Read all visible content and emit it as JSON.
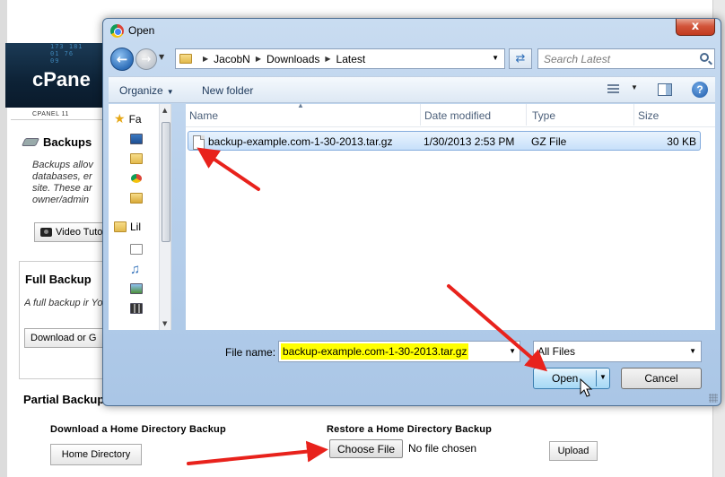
{
  "background": {
    "header_digits": "173 181\n01 76\n09",
    "logo": "cPane",
    "version": "CPANEL 11",
    "backups_title": "Backups",
    "backups_desc": "Backups allov databases, er site. These ar owner/admin",
    "video_button": "Video Tuto",
    "full_backup_title": "Full Backup",
    "full_backup_desc": "A full backup ir You can back u",
    "full_backup_button": "Download or G",
    "partial_backup_title": "Partial Backup",
    "download_home_title": "Download a Home Directory Backup",
    "home_directory_button": "Home Directory",
    "restore_home_title": "Restore a Home Directory Backup",
    "choose_file_button": "Choose File",
    "no_file_text": "No file chosen",
    "upload_button": "Upload"
  },
  "dialog": {
    "title": "Open",
    "close_label": "x",
    "breadcrumb": [
      "JacobN",
      "Downloads",
      "Latest"
    ],
    "search_placeholder": "Search Latest",
    "toolbar": {
      "organize": "Organize",
      "new_folder": "New folder",
      "help": "?"
    },
    "nav_pane": [
      {
        "label": "Fa",
        "icon": "star-icon"
      },
      {
        "label": "",
        "icon": "desktop-icon"
      },
      {
        "label": "",
        "icon": "downloads-icon"
      },
      {
        "label": "",
        "icon": "chrome-icon"
      },
      {
        "label": "",
        "icon": "uploads-icon"
      },
      {
        "label": "Lil",
        "icon": "libraries-icon"
      },
      {
        "label": "",
        "icon": "documents-icon"
      },
      {
        "label": "",
        "icon": "music-icon"
      },
      {
        "label": "",
        "icon": "pictures-icon"
      },
      {
        "label": "",
        "icon": "videos-icon"
      }
    ],
    "columns": {
      "name": "Name",
      "date_modified": "Date modified",
      "type": "Type",
      "size": "Size"
    },
    "files": [
      {
        "name": "backup-example.com-1-30-2013.tar.gz",
        "date_modified": "1/30/2013 2:53 PM",
        "type": "GZ File",
        "size": "30 KB"
      }
    ],
    "file_name_label": "File name:",
    "file_name_value": "backup-example.com-1-30-2013.tar.gz",
    "file_type_value": "All Files",
    "open_button": "Open",
    "cancel_button": "Cancel"
  },
  "colors": {
    "arrow": "#e8221c",
    "filename_highlight": "#ffff00",
    "selection": "#c7e0fa"
  }
}
